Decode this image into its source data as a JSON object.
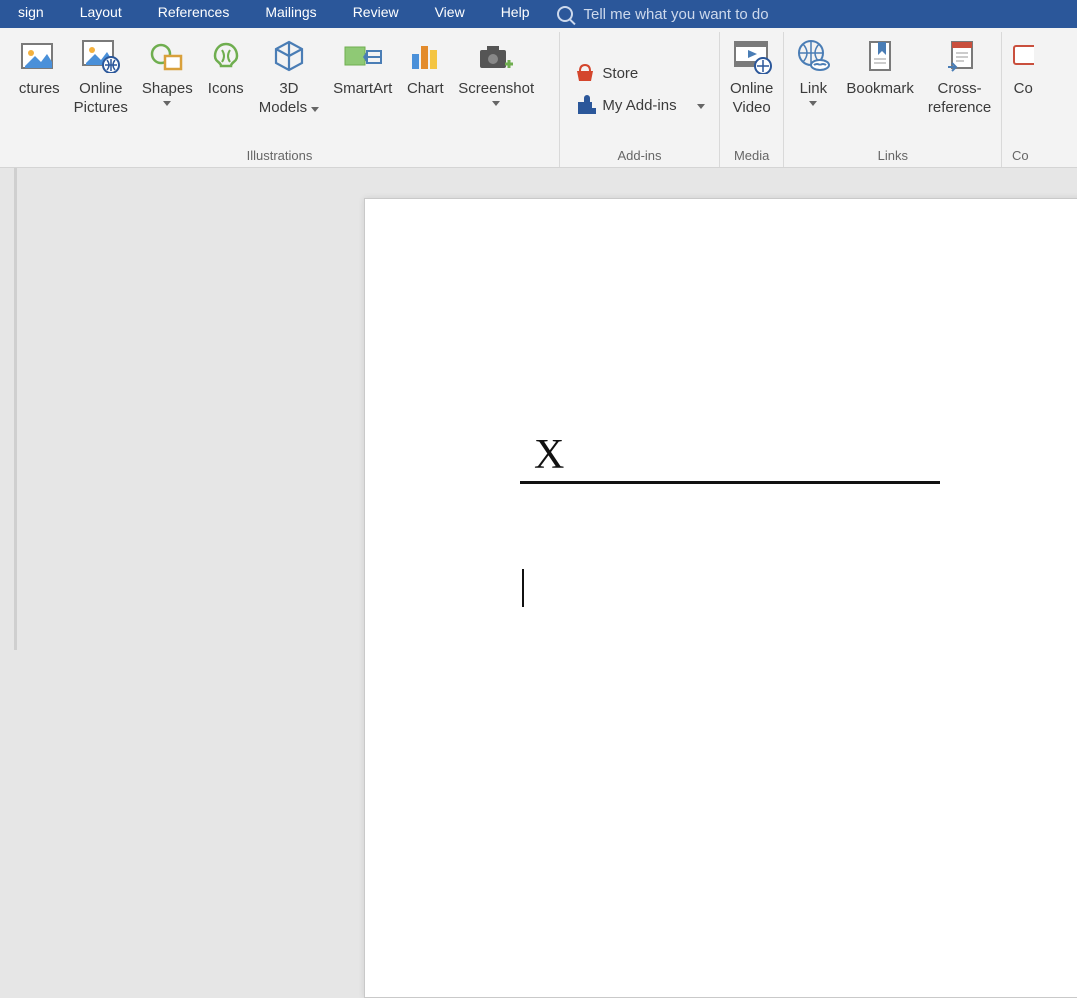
{
  "tabs": {
    "design": "sign",
    "layout": "Layout",
    "references": "References",
    "mailings": "Mailings",
    "review": "Review",
    "view": "View",
    "help": "Help"
  },
  "tellme": {
    "placeholder": "Tell me what you want to do"
  },
  "ribbon": {
    "illustrations": {
      "label": "Illustrations",
      "pictures": "ctures",
      "online_pictures": "Online",
      "online_pictures2": "Pictures",
      "shapes": "Shapes",
      "icons": "Icons",
      "models3d": "3D",
      "models3d2": "Models",
      "smartart": "SmartArt",
      "chart": "Chart",
      "screenshot": "Screenshot"
    },
    "addins": {
      "label": "Add-ins",
      "store": "Store",
      "myaddins": "My Add-ins"
    },
    "media": {
      "label": "Media",
      "online_video": "Online",
      "online_video2": "Video"
    },
    "links": {
      "label": "Links",
      "link": "Link",
      "bookmark": "Bookmark",
      "crossref": "Cross-",
      "crossref2": "reference"
    },
    "comments": {
      "label": "Co",
      "comment": "Co"
    }
  },
  "document": {
    "signature_x": "X"
  }
}
